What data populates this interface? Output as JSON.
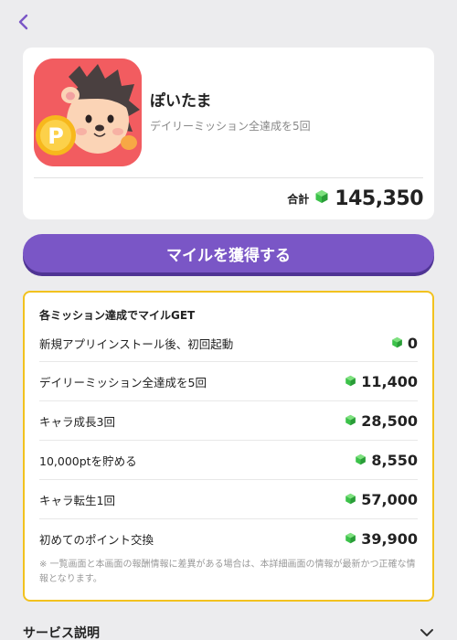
{
  "nav": {
    "back_icon": "chevron-left-icon"
  },
  "app": {
    "name": "ぽいたま",
    "subtitle": "デイリーミッション全達成を5回",
    "total_label": "合計",
    "total_value": "145,350",
    "icon": "app-icon-hedgehog"
  },
  "earn_button": {
    "label": "マイルを獲得する"
  },
  "missions": {
    "header": "各ミッション達成でマイルGET",
    "items": [
      {
        "label": "新規アプリインストール後、初回起動",
        "value": "0"
      },
      {
        "label": "デイリーミッション全達成を5回",
        "value": "11,400"
      },
      {
        "label": "キャラ成長3回",
        "value": "28,500"
      },
      {
        "label": "10,000ptを貯める",
        "value": "8,550"
      },
      {
        "label": "キャラ転生1回",
        "value": "57,000"
      },
      {
        "label": "初めてのポイント交換",
        "value": "39,900"
      }
    ],
    "note": "※ 一覧画面と本画面の報酬情報に差異がある場合は、本詳細画面の情報が最新かつ正確な情報となります。"
  },
  "service": {
    "label": "サービス説明",
    "chevron_icon": "chevron-down-icon"
  },
  "colors": {
    "accent": "#7a56c6",
    "border_highlight": "#f2c21f",
    "gem": "#3cc24a",
    "background": "#ececee"
  }
}
